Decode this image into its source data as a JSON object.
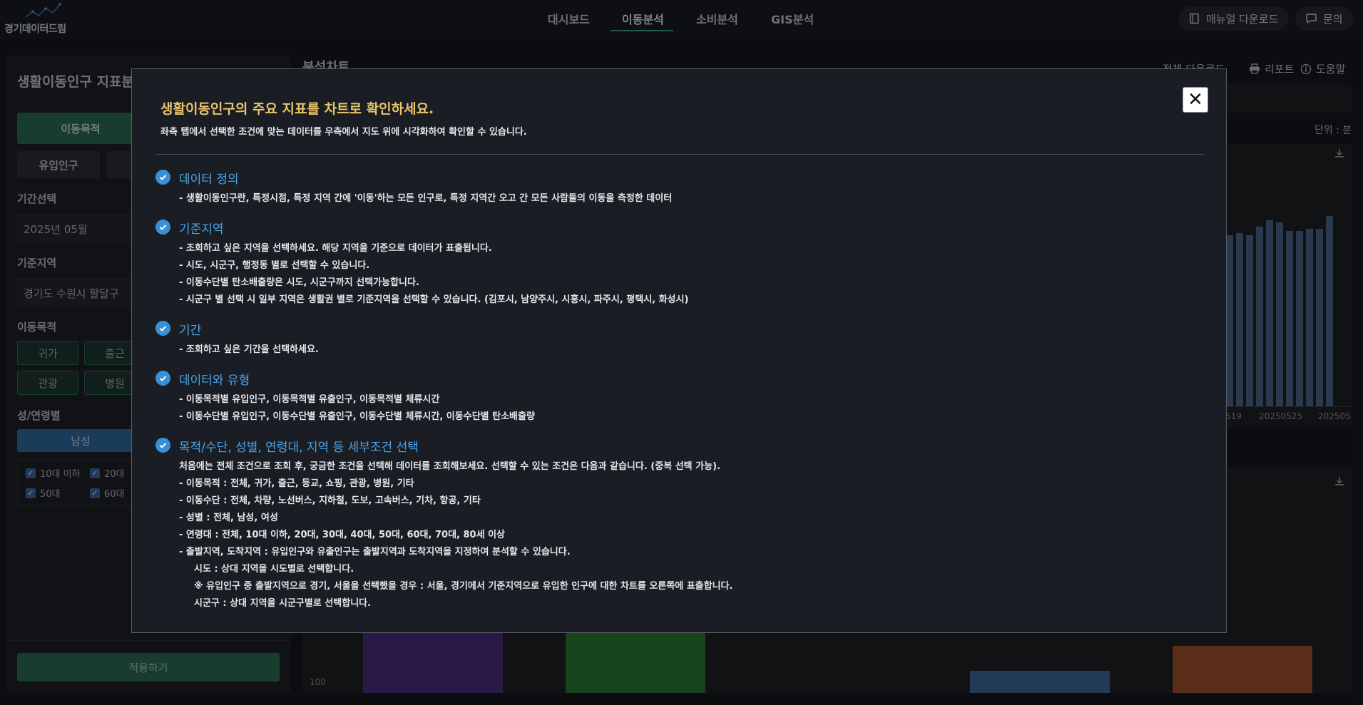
{
  "header": {
    "logo_text": "경기데이터드림",
    "nav": [
      "대시보드",
      "이동분석",
      "소비분석",
      "GIS분석"
    ],
    "manual_button": "매뉴얼 다운로드",
    "inquiry_button": "문의"
  },
  "left": {
    "title": "생활이동인구 지표분",
    "tab_active": "이동목적",
    "tab_inflow": "유입인구",
    "period_label": "기간선택",
    "period_value": "2025년 05월",
    "region_label": "기준지역",
    "region_value": "경기도 수원시 팔달구",
    "purpose_label": "이동목적",
    "purpose_chips": [
      "귀가",
      "출근",
      "관광",
      "병원"
    ],
    "gender_label": "성/연령별",
    "gender_male": "남성",
    "ages": [
      "10대 이하",
      "20대",
      "50대",
      "60대"
    ],
    "apply": "적용하기"
  },
  "right": {
    "title": "분석차트",
    "download_all": "전체 다운로드",
    "report": "리포트",
    "help": "도움말",
    "unit": "단위 : 분",
    "x_ticks": [
      "519",
      "20250525",
      "202505"
    ],
    "y_tick": "100",
    "top_bar_heights": [
      0.8,
      0.81,
      0.8,
      0.84,
      0.87,
      0.86,
      0.82,
      0.82,
      0.83,
      0.83,
      0.89
    ],
    "bottom_bar_colors": [
      "#4a2f86",
      "#2b7a35",
      "#3f6a9a",
      "#a4532c"
    ]
  },
  "modal": {
    "heading": "생활이동인구의 주요 지표를 차트로 확인하세요.",
    "subheading": "좌측 탭에서 선택한 조건에 맞는 데이터를 우측에서 지도 위에 시각화하여 확인할 수 있습니다.",
    "close": "✕",
    "sections": [
      {
        "title": "데이터 정의",
        "lines": [
          "- 생활이동인구란, 특정시점, 특정 지역 간에 '이동'하는 모든 인구로, 특정 지역간 오고 간 모든 사람들의 이동을 측정한 데이터"
        ]
      },
      {
        "title": "기준지역",
        "lines": [
          "- 조회하고 싶은 지역을 선택하세요. 해당 지역을 기준으로 데이터가 표출됩니다.",
          "- 시도, 시군구, 행정동 별로 선택할 수 있습니다.",
          "- 이동수단별 탄소배출량은 시도, 시군구까지 선택가능합니다.",
          "- 시군구 별 선택 시 일부 지역은 생활권 별로 기준지역을 선택할 수 있습니다. (김포시, 남양주시, 시흥시, 파주시, 평택시, 화성시)"
        ]
      },
      {
        "title": "기간",
        "lines": [
          "- 조회하고 싶은 기간을 선택하세요."
        ]
      },
      {
        "title": "데이터와 유형",
        "lines": [
          "- 이동목적별 유입인구, 이동목적별 유출인구, 이동목적별 체류시간",
          "- 이동수단별 유입인구, 이동수단별 유출인구, 이동수단별 체류시간, 이동수단별 탄소배출량"
        ]
      },
      {
        "title": "목적/수단, 성별, 연령대, 지역 등 세부조건 선택",
        "lines": [
          "처음에는 전체 조건으로 조회 후, 궁금한 조건을 선택해 데이터를 조회해보세요. 선택할 수 있는 조건은 다음과 같습니다. (중복 선택 가능).",
          "-  이동목적 : 전체, 귀가, 출근, 등교, 쇼핑, 관광, 병원, 기타",
          "- 이동수단 : 전체, 차량, 노선버스, 지하철, 도보, 고속버스, 기차, 항공, 기타",
          "- 성별 : 전체, 남성, 여성",
          "- 연령대 : 전체, 10대 이하, 20대, 30대, 40대, 50대, 60대, 70대, 80세 이상",
          "- 출발지역, 도착지역 : 유입인구와 유출인구는 출발지역과 도착지역을 지정하여 분석할 수 있습니다.",
          "시도 : 상대 지역을 시도별로 선택합니다.",
          "※ 유입인구 중 출발지역으로 경기, 서울을 선택했을 경우 : 서울, 경기에서 기준지역으로 유입한 인구에 대한 차트를 오른쪽에 표출합니다.",
          "시군구 : 상대 지역을 시군구별로 선택합니다."
        ]
      }
    ]
  }
}
